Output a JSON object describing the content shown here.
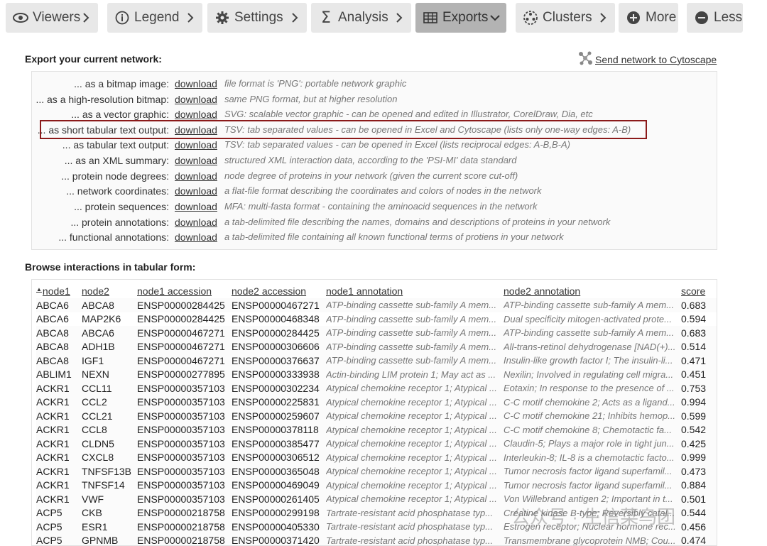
{
  "toolbar": {
    "buttons": [
      {
        "label": "Viewers",
        "icon": "eye-icon"
      },
      {
        "label": "Legend",
        "icon": "info-icon"
      },
      {
        "label": "Settings",
        "icon": "gear-icon"
      },
      {
        "label": "Analysis",
        "icon": "sigma-icon"
      },
      {
        "label": "Exports",
        "icon": "table-icon",
        "active": true
      },
      {
        "label": "Clusters",
        "icon": "clusters-icon"
      },
      {
        "label": "More",
        "icon": "plus-icon"
      },
      {
        "label": "Less",
        "icon": "minus-icon"
      }
    ]
  },
  "exports": {
    "title": "Export your current network:",
    "cytoscape_link": "Send network to Cytoscape",
    "rows": [
      {
        "label": "... as a bitmap image:",
        "link": "download",
        "desc": "file format is 'PNG': portable network graphic"
      },
      {
        "label": "... as a high-resolution bitmap:",
        "link": "download",
        "desc": "same PNG format, but at higher resolution"
      },
      {
        "label": "... as a vector graphic:",
        "link": "download",
        "desc": "SVG: scalable vector graphic - can be opened and edited in Illustrator, CorelDraw, Dia, etc"
      },
      {
        "label": "... as short tabular text output:",
        "link": "download",
        "desc": "TSV: tab separated values - can be opened in Excel and Cytoscape (lists only one-way edges: A-B)"
      },
      {
        "label": "... as tabular text output:",
        "link": "download",
        "desc": "TSV: tab separated values - can be opened in Excel (lists reciprocal edges: A-B,B-A)"
      },
      {
        "label": "... as an XML summary:",
        "link": "download",
        "desc": "structured XML interaction data, according to the 'PSI-MI' data standard"
      },
      {
        "label": "... protein node degrees:",
        "link": "download",
        "desc": "node degree of proteins in your network (given the current score cut-off)"
      },
      {
        "label": "... network coordinates:",
        "link": "download",
        "desc": "a flat-file format describing the coordinates and colors of nodes in the network"
      },
      {
        "label": "... protein sequences:",
        "link": "download",
        "desc": "MFA: multi-fasta format - containing the aminoacid sequences in the network"
      },
      {
        "label": "... protein annotations:",
        "link": "download",
        "desc": "a tab-delimited file describing the names, domains and descriptions of proteins in your network"
      },
      {
        "label": "... functional annotations:",
        "link": "download",
        "desc": "a tab-delimited file containing all known functional terms of protiens in your network"
      }
    ]
  },
  "interactions": {
    "title": "Browse interactions in tabular form:",
    "columns": [
      "node1",
      "node2",
      "node1 accession",
      "node2 accession",
      "node1 annotation",
      "node2 annotation",
      "score"
    ],
    "sort_indicator": "▲",
    "rows": [
      [
        "ABCA6",
        "ABCA8",
        "ENSP00000284425",
        "ENSP00000467271",
        "ATP-binding cassette sub-family A mem...",
        "ATP-binding cassette sub-family A mem...",
        "0.683"
      ],
      [
        "ABCA6",
        "MAP2K6",
        "ENSP00000284425",
        "ENSP00000468348",
        "ATP-binding cassette sub-family A mem...",
        "Dual specificity mitogen-activated prote...",
        "0.594"
      ],
      [
        "ABCA8",
        "ABCA6",
        "ENSP00000467271",
        "ENSP00000284425",
        "ATP-binding cassette sub-family A mem...",
        "ATP-binding cassette sub-family A mem...",
        "0.683"
      ],
      [
        "ABCA8",
        "ADH1B",
        "ENSP00000467271",
        "ENSP00000306606",
        "ATP-binding cassette sub-family A mem...",
        "All-trans-retinol dehydrogenase [NAD(+)...",
        "0.514"
      ],
      [
        "ABCA8",
        "IGF1",
        "ENSP00000467271",
        "ENSP00000376637",
        "ATP-binding cassette sub-family A mem...",
        "Insulin-like growth factor I; The insulin-li...",
        "0.471"
      ],
      [
        "ABLIM1",
        "NEXN",
        "ENSP00000277895",
        "ENSP00000333938",
        "Actin-binding LIM protein 1; May act as ...",
        "Nexilin; Involved in regulating cell migra...",
        "0.451"
      ],
      [
        "ACKR1",
        "CCL11",
        "ENSP00000357103",
        "ENSP00000302234",
        "Atypical chemokine receptor 1; Atypical ...",
        "Eotaxin; In response to the presence of ...",
        "0.753"
      ],
      [
        "ACKR1",
        "CCL2",
        "ENSP00000357103",
        "ENSP00000225831",
        "Atypical chemokine receptor 1; Atypical ...",
        "C-C motif chemokine 2; Acts as a ligand...",
        "0.994"
      ],
      [
        "ACKR1",
        "CCL21",
        "ENSP00000357103",
        "ENSP00000259607",
        "Atypical chemokine receptor 1; Atypical ...",
        "C-C motif chemokine 21; Inhibits hemop...",
        "0.599"
      ],
      [
        "ACKR1",
        "CCL8",
        "ENSP00000357103",
        "ENSP00000378118",
        "Atypical chemokine receptor 1; Atypical ...",
        "C-C motif chemokine 8; Chemotactic fa...",
        "0.542"
      ],
      [
        "ACKR1",
        "CLDN5",
        "ENSP00000357103",
        "ENSP00000385477",
        "Atypical chemokine receptor 1; Atypical ...",
        "Claudin-5; Plays a major role in tight jun...",
        "0.425"
      ],
      [
        "ACKR1",
        "CXCL8",
        "ENSP00000357103",
        "ENSP00000306512",
        "Atypical chemokine receptor 1; Atypical ...",
        "Interleukin-8; IL-8 is a chemotactic facto...",
        "0.999"
      ],
      [
        "ACKR1",
        "TNFSF13B",
        "ENSP00000357103",
        "ENSP00000365048",
        "Atypical chemokine receptor 1; Atypical ...",
        "Tumor necrosis factor ligand superfamil...",
        "0.473"
      ],
      [
        "ACKR1",
        "TNFSF14",
        "ENSP00000357103",
        "ENSP00000469049",
        "Atypical chemokine receptor 1; Atypical ...",
        "Tumor necrosis factor ligand superfamil...",
        "0.884"
      ],
      [
        "ACKR1",
        "VWF",
        "ENSP00000357103",
        "ENSP00000261405",
        "Atypical chemokine receptor 1; Atypical ...",
        "Von Willebrand antigen 2; Important in t...",
        "0.501"
      ],
      [
        "ACP5",
        "CKB",
        "ENSP00000218758",
        "ENSP00000299198",
        "Tartrate-resistant acid phosphatase typ...",
        "Creatine kinase B-type; Reversibly catal...",
        "0.544"
      ],
      [
        "ACP5",
        "ESR1",
        "ENSP00000218758",
        "ENSP00000405330",
        "Tartrate-resistant acid phosphatase typ...",
        "Estrogen receptor; Nuclear hormone rec...",
        "0.456"
      ],
      [
        "ACP5",
        "GPNMB",
        "ENSP00000218758",
        "ENSP00000371420",
        "Tartrate-resistant acid phosphatase typ...",
        "Transmembrane glycoprotein NMB; Cou...",
        "0.474"
      ]
    ]
  },
  "watermark": {
    "text": "公众号 · 生信菜鸟团"
  },
  "colors": {
    "highlight_border": "#8b1a1a",
    "active_button": "#b3b3b3",
    "button_bg": "#e8e8e8"
  }
}
